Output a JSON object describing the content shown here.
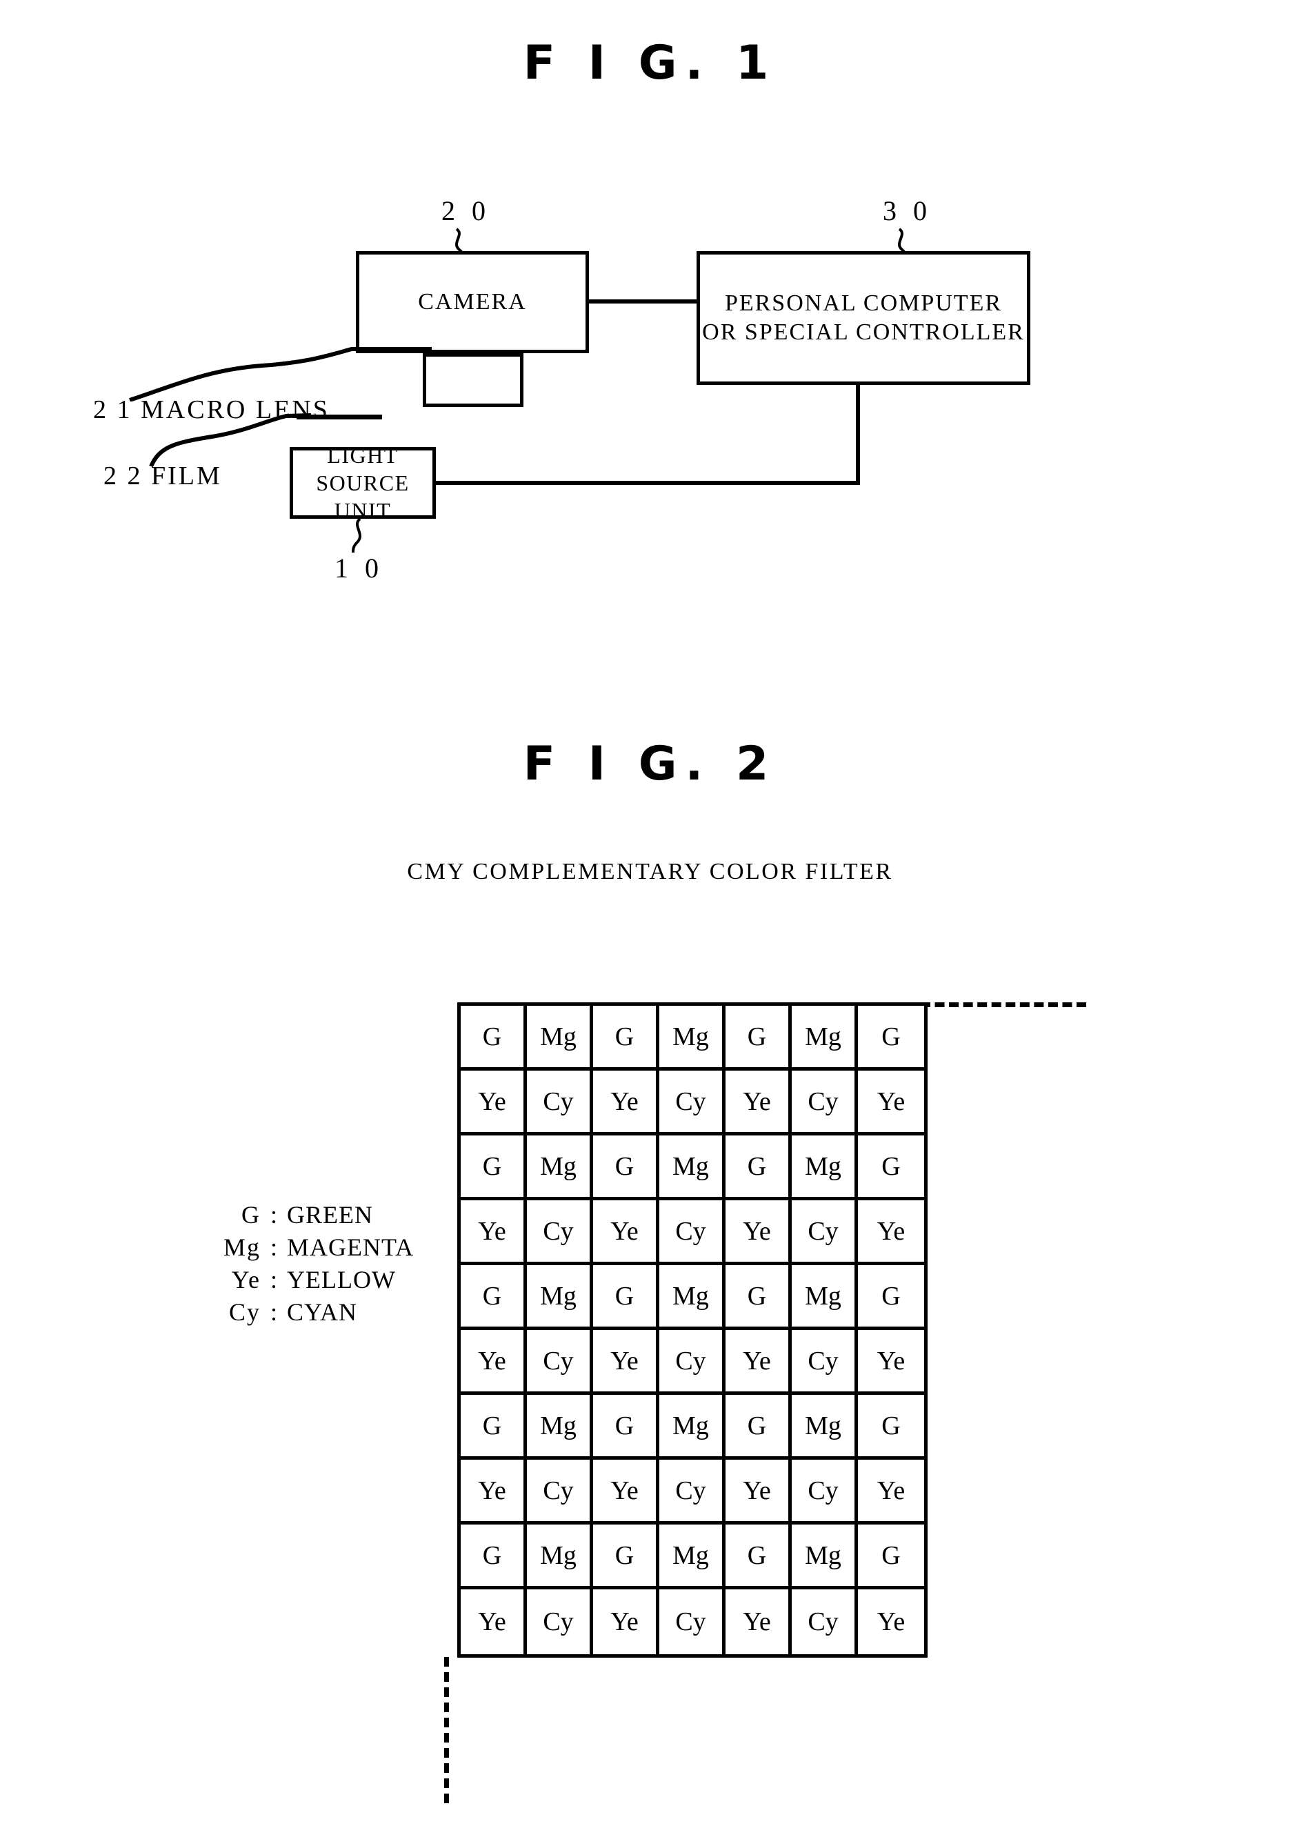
{
  "figure1": {
    "title": "F I G.  1",
    "blocks": [
      {
        "id": "camera",
        "label": "CAMERA"
      },
      {
        "id": "controller",
        "label": "PERSONAL COMPUTER\nOR SPECIAL CONTROLLER"
      },
      {
        "id": "light-source",
        "label": "LIGHT SOURCE UNIT"
      }
    ],
    "reference_numerals": [
      {
        "id": "camera-ref",
        "value": "2 0"
      },
      {
        "id": "controller-ref",
        "value": "3 0"
      },
      {
        "id": "light-source-ref",
        "value": "1 0"
      }
    ],
    "callout_labels": [
      {
        "id": "macro-lens",
        "value": "2 1  MACRO LENS"
      },
      {
        "id": "film",
        "value": "2 2  FILM"
      }
    ]
  },
  "figure2": {
    "title": "F I G.  2",
    "subtitle": "CMY COMPLEMENTARY COLOR FILTER",
    "legend": [
      {
        "symbol": "G",
        "colon": ":",
        "name": "GREEN"
      },
      {
        "symbol": "Mg",
        "colon": ":",
        "name": "MAGENTA"
      },
      {
        "symbol": "Ye",
        "colon": ":",
        "name": "YELLOW"
      },
      {
        "symbol": "Cy",
        "colon": ":",
        "name": "CYAN"
      }
    ],
    "chart_data": {
      "type": "table",
      "title": "CMY COMPLEMENTARY COLOR FILTER",
      "columns": 7,
      "rows": 10,
      "cells": [
        [
          "G",
          "Mg",
          "G",
          "Mg",
          "G",
          "Mg",
          "G"
        ],
        [
          "Ye",
          "Cy",
          "Ye",
          "Cy",
          "Ye",
          "Cy",
          "Ye"
        ],
        [
          "G",
          "Mg",
          "G",
          "Mg",
          "G",
          "Mg",
          "G"
        ],
        [
          "Ye",
          "Cy",
          "Ye",
          "Cy",
          "Ye",
          "Cy",
          "Ye"
        ],
        [
          "G",
          "Mg",
          "G",
          "Mg",
          "G",
          "Mg",
          "G"
        ],
        [
          "Ye",
          "Cy",
          "Ye",
          "Cy",
          "Ye",
          "Cy",
          "Ye"
        ],
        [
          "G",
          "Mg",
          "G",
          "Mg",
          "G",
          "Mg",
          "G"
        ],
        [
          "Ye",
          "Cy",
          "Ye",
          "Cy",
          "Ye",
          "Cy",
          "Ye"
        ],
        [
          "G",
          "Mg",
          "G",
          "Mg",
          "G",
          "Mg",
          "G"
        ],
        [
          "Ye",
          "Cy",
          "Ye",
          "Cy",
          "Ye",
          "Cy",
          "Ye"
        ]
      ]
    }
  },
  "colors": {
    "ink": "#000000",
    "paper": "#ffffff"
  }
}
